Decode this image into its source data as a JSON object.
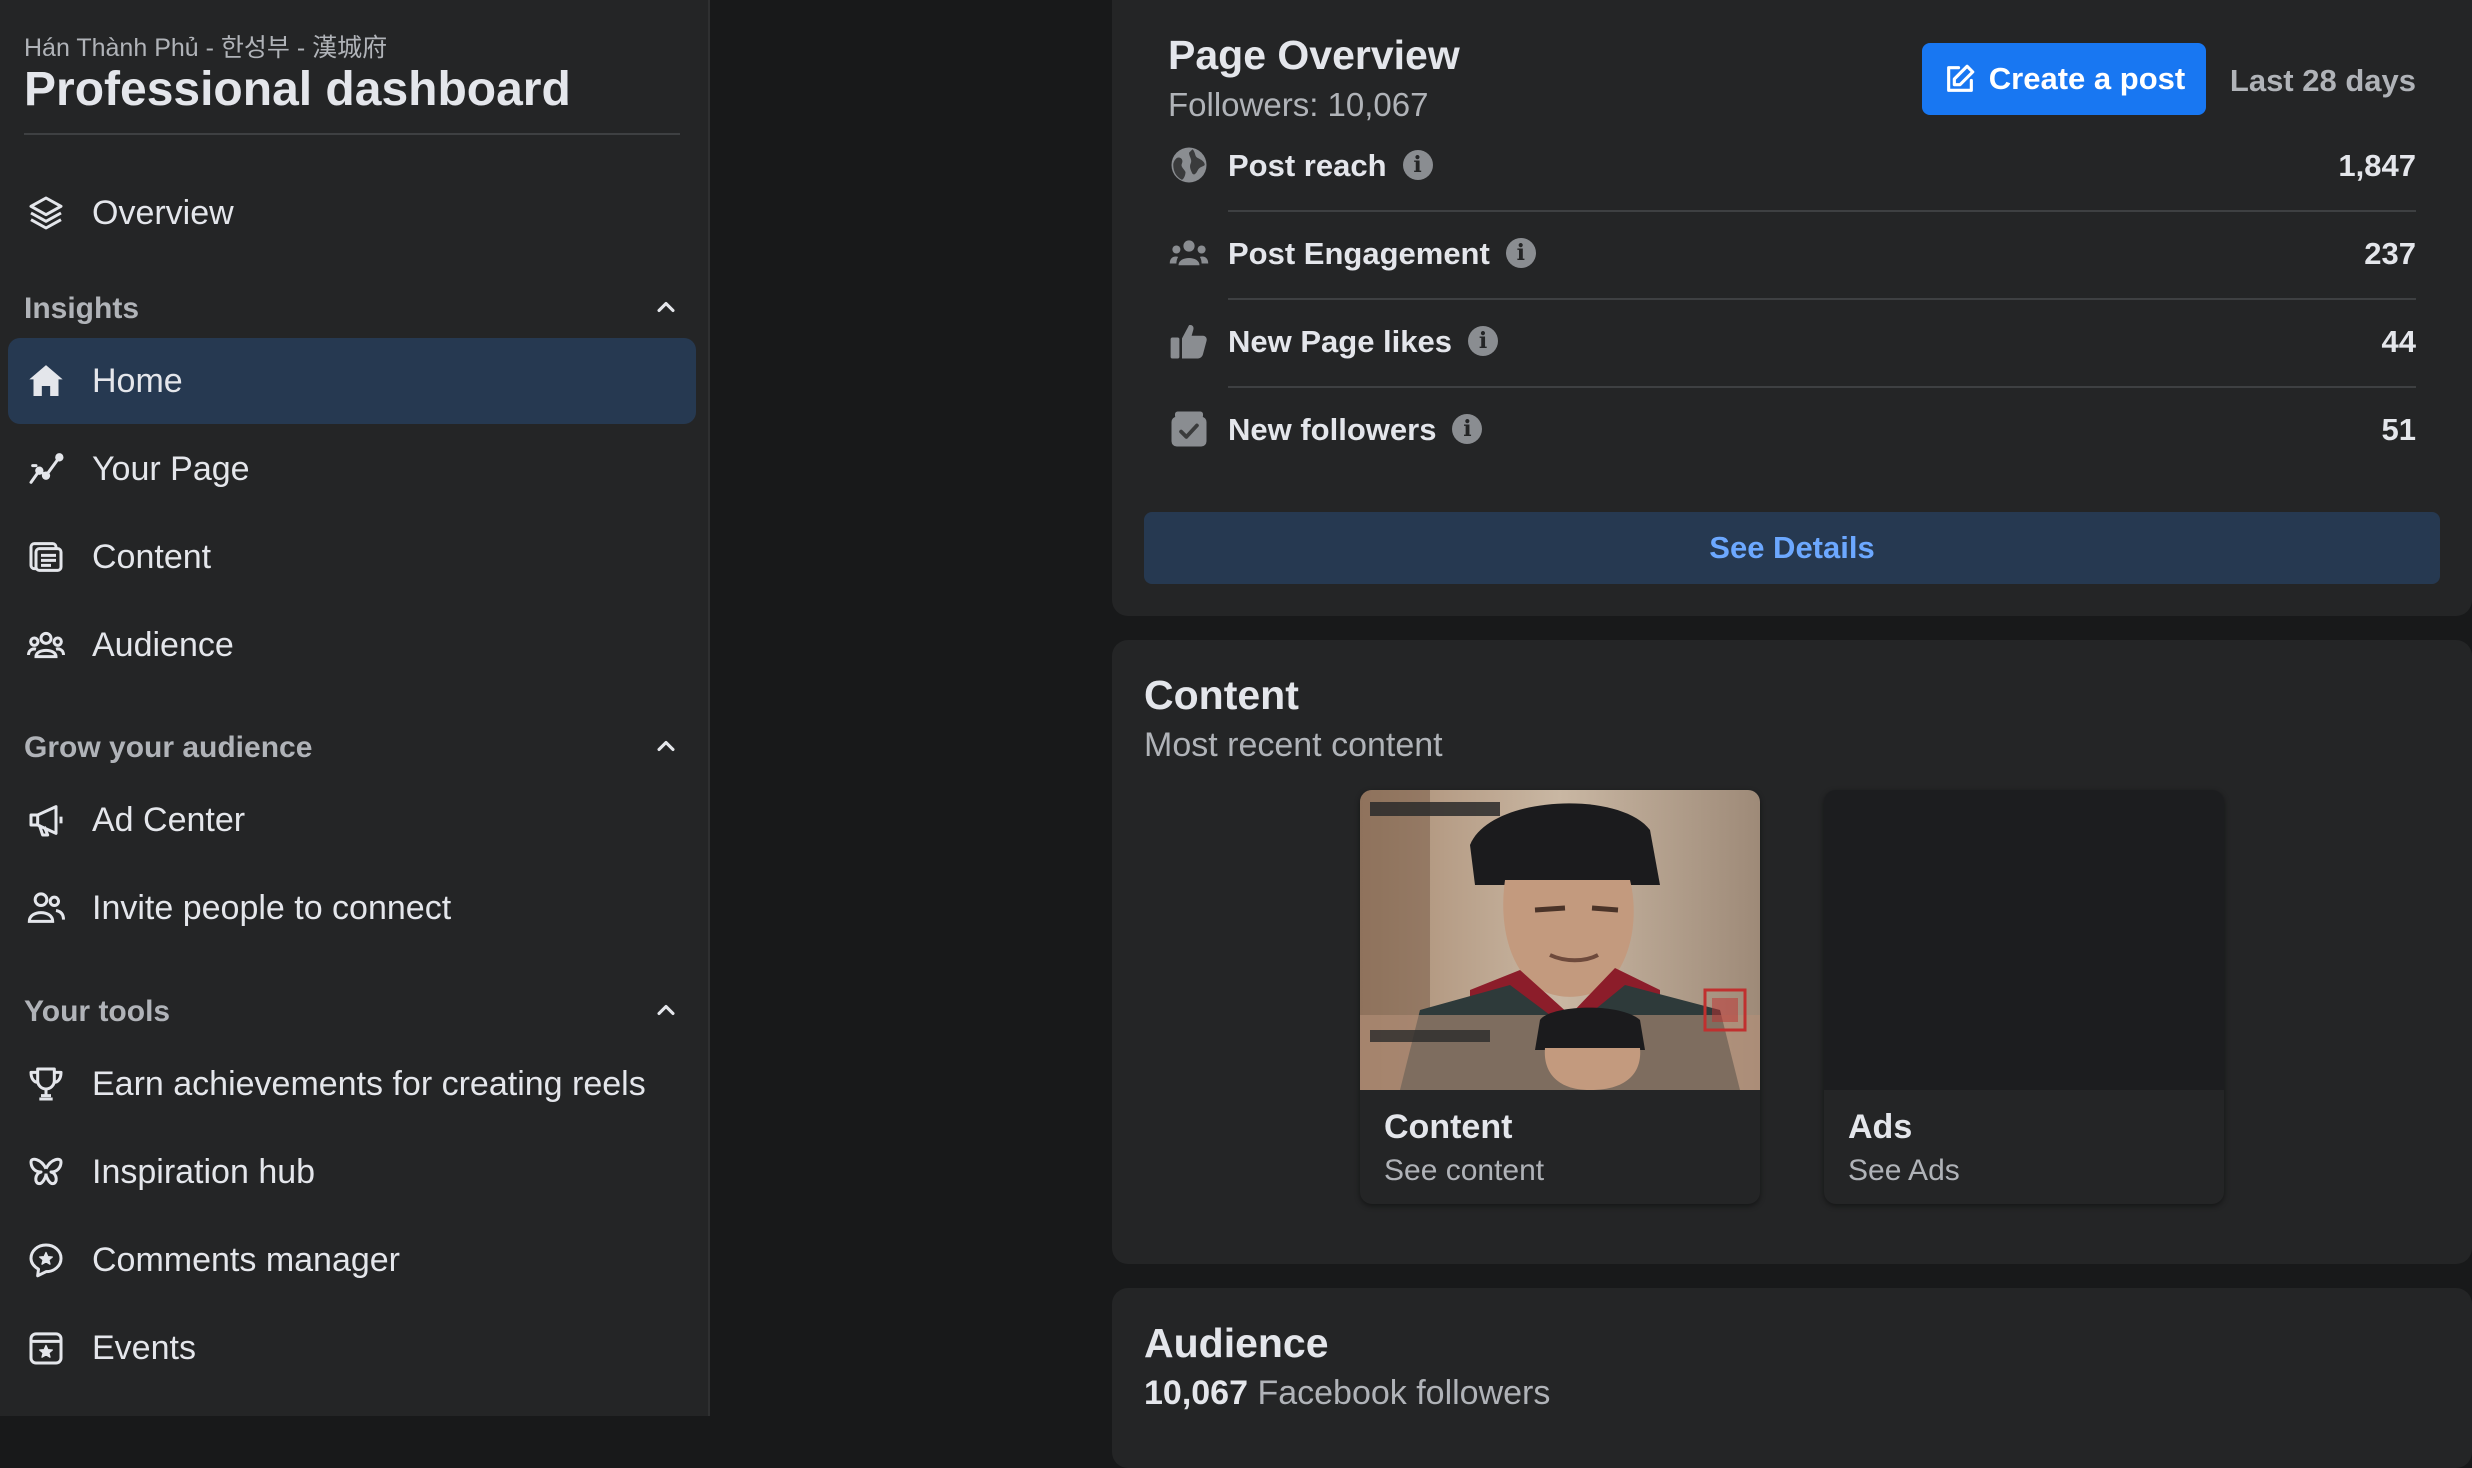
{
  "sidebar": {
    "page_name": "Hán Thành Phủ - 한성부 - 漢城府",
    "title": "Professional dashboard",
    "overview": {
      "label": "Overview",
      "icon": "layers-icon"
    },
    "sections": [
      {
        "label": "Insights",
        "items": [
          {
            "label": "Home",
            "icon": "home-icon",
            "active": true
          },
          {
            "label": "Your Page",
            "icon": "trend-icon"
          },
          {
            "label": "Content",
            "icon": "content-icon"
          },
          {
            "label": "Audience",
            "icon": "people-group-icon"
          }
        ]
      },
      {
        "label": "Grow your audience",
        "items": [
          {
            "label": "Ad Center",
            "icon": "megaphone-icon"
          },
          {
            "label": "Invite people to connect",
            "icon": "invite-people-icon"
          }
        ]
      },
      {
        "label": "Your tools",
        "items": [
          {
            "label": "Earn achievements for creating reels",
            "icon": "trophy-icon"
          },
          {
            "label": "Inspiration hub",
            "icon": "butterfly-icon"
          },
          {
            "label": "Comments manager",
            "icon": "comment-star-icon"
          },
          {
            "label": "Events",
            "icon": "calendar-star-icon"
          }
        ]
      }
    ]
  },
  "overview": {
    "title": "Page Overview",
    "followers": "Followers: 10,067",
    "create_post_label": "Create a post",
    "date_range": "Last 28 days",
    "metrics": [
      {
        "label": "Post reach",
        "value": "1,847",
        "icon": "globe-icon"
      },
      {
        "label": "Post Engagement",
        "value": "237",
        "icon": "people-icon"
      },
      {
        "label": "New Page likes",
        "value": "44",
        "icon": "thumbs-up-icon"
      },
      {
        "label": "New followers",
        "value": "51",
        "icon": "follower-check-icon"
      }
    ],
    "info_glyph": "i",
    "see_details_label": "See Details"
  },
  "content": {
    "title": "Content",
    "subtitle": "Most recent content",
    "tiles": [
      {
        "label": "Content",
        "link": "See content"
      },
      {
        "label": "Ads",
        "link": "See Ads"
      }
    ]
  },
  "audience": {
    "title": "Audience",
    "followers_count": "10,067",
    "followers_text": "Facebook followers"
  },
  "colors": {
    "accent": "#1877f2",
    "active_bg": "#263951",
    "link_blue": "#6ca8ff",
    "card_bg": "#242526",
    "page_bg": "#18191a"
  }
}
